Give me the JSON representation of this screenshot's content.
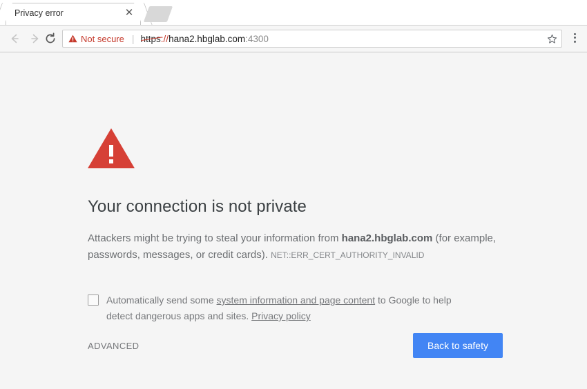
{
  "browser": {
    "tab": {
      "title": "Privacy error",
      "close_icon": "close-icon"
    },
    "new_tab_icon": "new-tab-icon",
    "nav": {
      "back_icon": "←",
      "forward_icon": "→",
      "reload_icon": "⟳"
    },
    "omnibox": {
      "security_icon": "warning-triangle-icon",
      "security_label": "Not secure",
      "separator": "|",
      "url_scheme": "https",
      "url_colon_slash": "://",
      "url_host": "hana2.hbglab.com",
      "url_port": ":4300",
      "full_url": "https://hana2.hbglab.com:4300",
      "bookmark_icon": "star-icon"
    },
    "menu_icon": "three-dot-menu-icon"
  },
  "interstitial": {
    "warning_icon": "red-warning-triangle-icon",
    "headline": "Your connection is not private",
    "body_part1": "Attackers might be trying to steal your information from ",
    "body_host": "hana2.hbglab.com",
    "body_part2": " (for example, passwords, messages, or credit cards). ",
    "error_code": "NET::ERR_CERT_AUTHORITY_INVALID",
    "optin": {
      "checked": false,
      "text_part1": "Automatically send some ",
      "link1": "system information and page content",
      "text_part2": " to Google to help detect dangerous apps and sites. ",
      "link2": "Privacy policy"
    },
    "advanced_label": "ADVANCED",
    "primary_button_label": "Back to safety"
  },
  "colors": {
    "danger": "#d64036",
    "primary": "#4285f4",
    "page_bg": "#f5f5f5",
    "text": "#6c6f72"
  }
}
